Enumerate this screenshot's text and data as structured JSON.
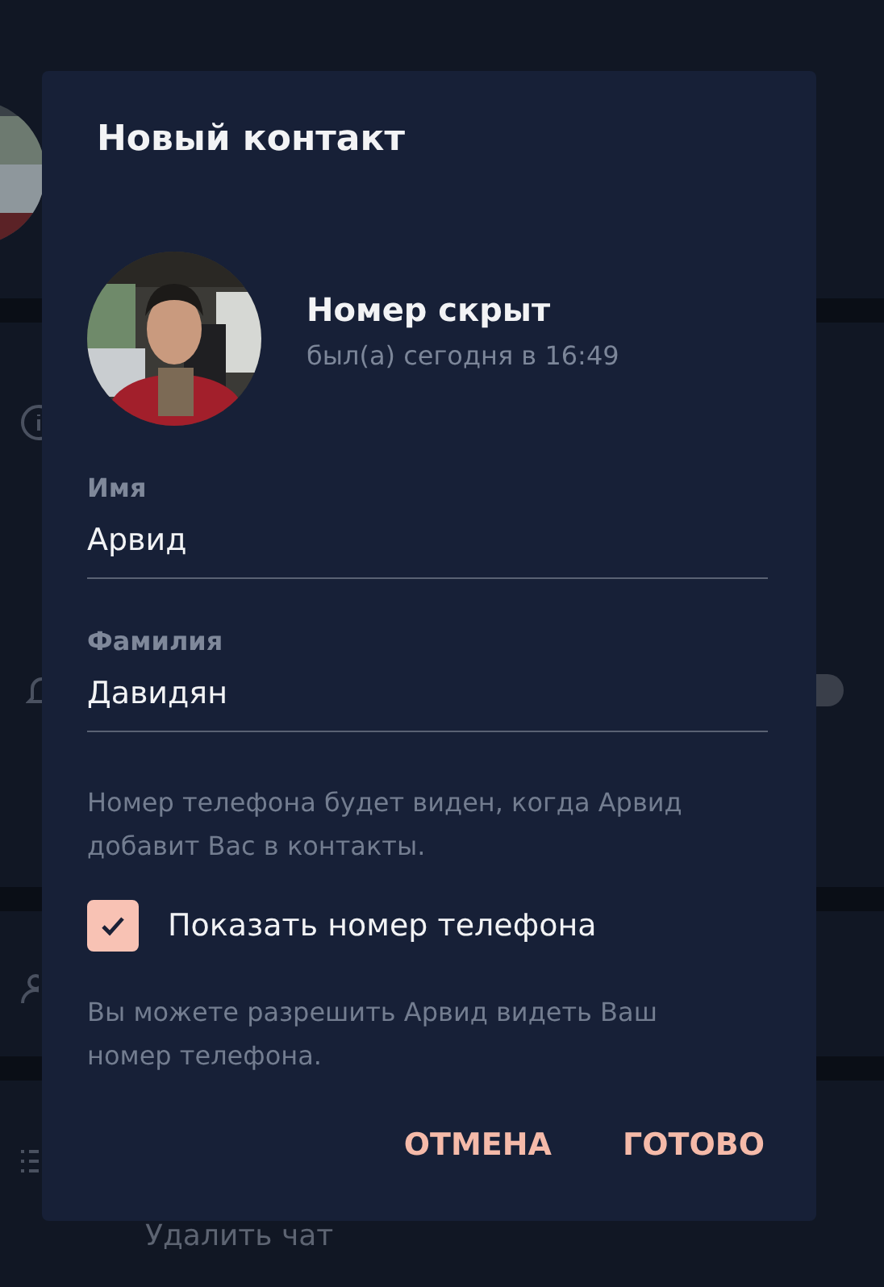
{
  "background": {
    "notifications_toggle": {
      "on": false
    },
    "delete_chat": "Удалить чат"
  },
  "dialog": {
    "title": "Новый контакт",
    "contact": {
      "name": "Номер скрыт",
      "status": "был(а) сегодня в 16:49"
    },
    "fields": [
      {
        "label": "Имя",
        "value": "Арвид"
      },
      {
        "label": "Фамилия",
        "value": "Давидян"
      }
    ],
    "phone_note": "Номер телефона будет виден, когда Арвид добавит Вас в контакты.",
    "share_phone": {
      "label": "Показать номер телефона",
      "checked": true
    },
    "share_note": "Вы можете разрешить Арвид видеть Ваш номер телефона.",
    "buttons": [
      {
        "label": "ОТМЕНА"
      },
      {
        "label": "ГОТОВО"
      }
    ]
  }
}
